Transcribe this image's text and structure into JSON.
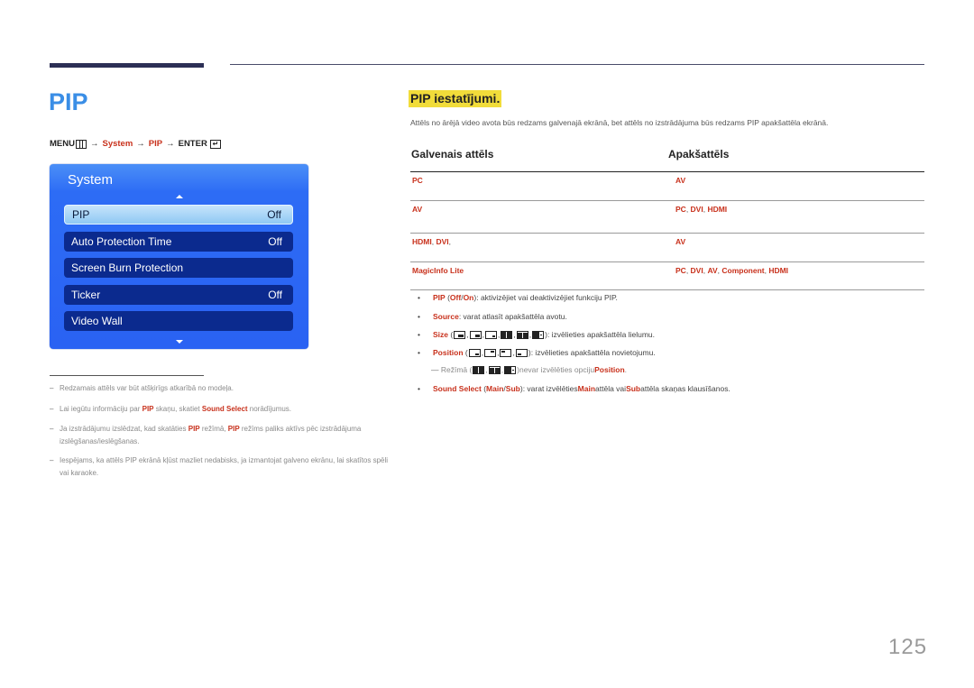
{
  "page": {
    "title": "PIP",
    "page_number": "125"
  },
  "breadcrumb": {
    "menu": "MENU",
    "arrow": "→",
    "system": "System",
    "pip": "PIP",
    "enter": "ENTER"
  },
  "osd": {
    "title": "System",
    "items": [
      {
        "label": "PIP",
        "value": "Off",
        "selected": true
      },
      {
        "label": "Auto Protection Time",
        "value": "Off"
      },
      {
        "label": "Screen Burn Protection",
        "value": ""
      },
      {
        "label": "Ticker",
        "value": "Off"
      },
      {
        "label": "Video Wall",
        "value": ""
      }
    ]
  },
  "notes": [
    {
      "text": "Redzamais attēls var būt atšķirīgs atkarībā no modeļa."
    },
    {
      "pre": "Lai iegūtu informāciju par ",
      "b1": "PIP",
      "mid": " skaņu, skatiet ",
      "b2": "Sound Select",
      "post": " norādījumus."
    },
    {
      "pre": "Ja izstrādājumu izslēdzat, kad skatāties ",
      "b1": "PIP",
      "mid": " režīmā, ",
      "b2": "PIP",
      "post": " režīms paliks aktīvs pēc izstrādājuma izslēgšanas/ieslēgšanas."
    },
    {
      "text": "Iespējams, ka attēls PIP ekrānā kļūst mazliet nedabisks, ja izmantojat galveno ekrānu, lai skatītos spēli vai karaoke."
    }
  ],
  "section": {
    "heading": "PIP iestatījumi.",
    "intro": "Attēls no ārējā video avota būs redzams galvenajā ekrānā, bet attēls no izstrādājuma būs redzams PIP apakšattēla ekrānā."
  },
  "table": {
    "headers": [
      "Galvenais attēls",
      "Apakšattēls"
    ],
    "rows": [
      {
        "main": [
          "PC"
        ],
        "sub": [
          "AV"
        ]
      },
      {
        "main": [
          "AV"
        ],
        "sub": [
          "PC",
          "DVI",
          "HDMI"
        ]
      },
      {
        "main": [
          "HDMI",
          "DVI",
          ""
        ],
        "sub": [
          "AV"
        ]
      },
      {
        "main": [
          "MagicInfo Lite"
        ],
        "sub": [
          "PC",
          "DVI",
          "AV",
          "Component",
          "HDMI"
        ]
      }
    ]
  },
  "bullets": {
    "pip": {
      "label": "PIP",
      "opt1": "Off",
      "opt2": "On",
      "desc": ": aktivizējiet vai deaktivizējiet funkciju PIP."
    },
    "source": {
      "label": "Source",
      "desc": ": varat atlasīt apakšattēla avotu."
    },
    "size": {
      "label": "Size",
      "desc": ": izvēlieties apakšattēla lielumu."
    },
    "position": {
      "label": "Position",
      "desc": ": izvēlieties apakšattēla novietojumu."
    },
    "subnote": {
      "pre": "Režīmā",
      "post": " nevar izvēlēties opciju ",
      "b": "Position",
      "end": "."
    },
    "sound": {
      "label": "Sound Select",
      "opt1": "Main",
      "opt2": "Sub",
      "desc1": ": varat izvēlēties ",
      "b1": "Main",
      "desc2": " attēla vai ",
      "b2": "Sub",
      "desc3": " attēla skaņas klausīšanos."
    }
  },
  "colors": {
    "title_blue": "#3a8ee6",
    "accent_red": "#c8311c",
    "highlight_yellow": "#f1dc3a",
    "osd_blue": "#2a62f3",
    "osd_item": "#0b2a8e"
  }
}
